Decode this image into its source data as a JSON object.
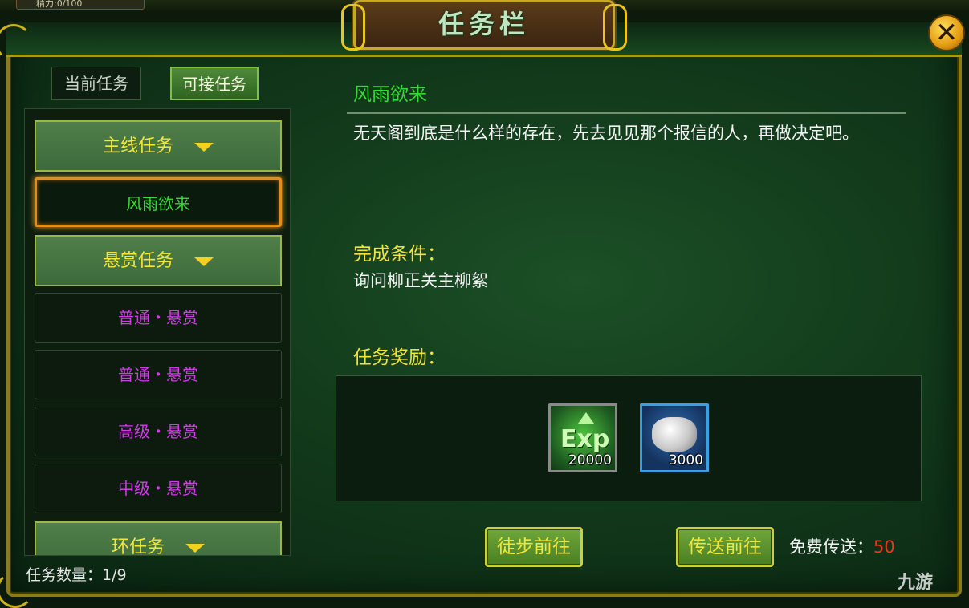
{
  "hud": {
    "stamina": "精力:0/100"
  },
  "window": {
    "title": "任务栏"
  },
  "tabs": [
    {
      "label": "当前任务",
      "active": false
    },
    {
      "label": "可接任务",
      "active": true
    }
  ],
  "quest_list": {
    "categories": [
      {
        "label": "主线任务"
      },
      {
        "label": "悬赏任务"
      },
      {
        "label": "环任务"
      }
    ],
    "items": [
      {
        "label": "风雨欲来",
        "color": "#38d838",
        "selected": true
      },
      {
        "label": "普通・悬赏",
        "color": "#d23ce6"
      },
      {
        "label": "普通・悬赏",
        "color": "#d23ce6"
      },
      {
        "label": "高级・悬赏",
        "color": "#d23ce6"
      },
      {
        "label": "中级・悬赏",
        "color": "#d23ce6"
      }
    ],
    "count_label": "任务数量：1/9"
  },
  "detail": {
    "quest_title": "风雨欲来",
    "description": "无天阁到底是什么样的存在，先去见见那个报信的人，再做决定吧。",
    "condition_label": "完成条件：",
    "condition_text": "询问柳正关主柳絮",
    "reward_label": "任务奖励：",
    "rewards": [
      {
        "icon": "exp-icon",
        "amount": "20000"
      },
      {
        "icon": "silver-ingot-icon",
        "amount": "3000"
      }
    ]
  },
  "actions": {
    "walk_label": "徒步前往",
    "teleport_label": "传送前往",
    "free_teleport_label": "免费传送：",
    "free_teleport_count": "50"
  },
  "watermark": "九游",
  "colors": {
    "accent_gold": "#c9b21c",
    "quest_green": "#36d936",
    "bounty_purple": "#d23ce6",
    "label_yellow": "#f2e33a",
    "count_red": "#e83a1a"
  }
}
